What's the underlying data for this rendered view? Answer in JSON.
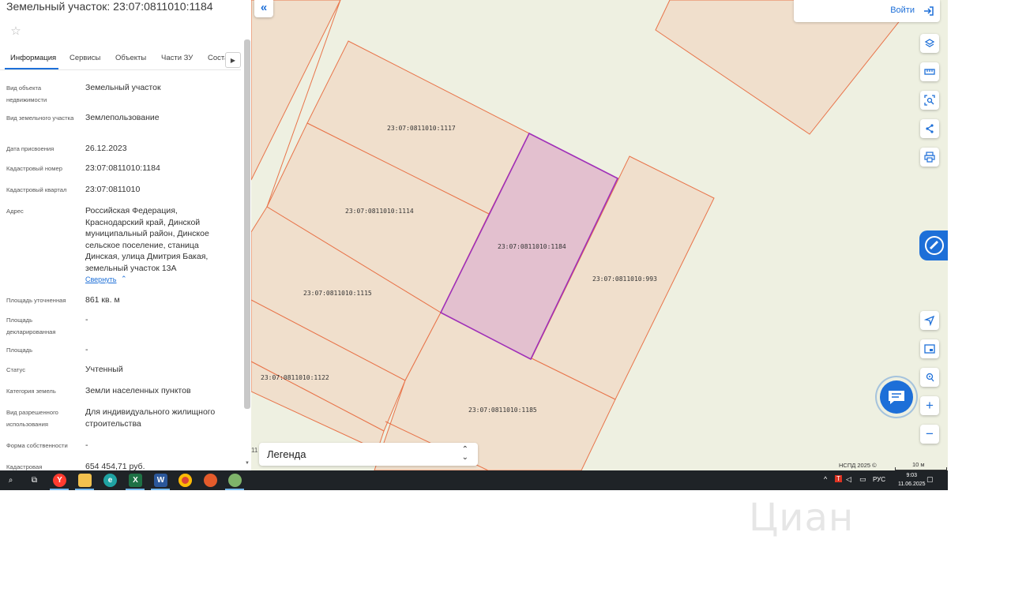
{
  "panel": {
    "title": "Земельный участок: 23:07:0811010:1184",
    "tabs": [
      "Информация",
      "Сервисы",
      "Объекты",
      "Части ЗУ",
      "Соста"
    ],
    "rows": [
      {
        "label": "Вид объекта недвижимости",
        "value": "Земельный участок"
      },
      {
        "label": "Вид земельного участка",
        "value": "Землепользование"
      },
      {
        "label": "Дата присвоения",
        "value": "26.12.2023"
      },
      {
        "label": "Кадастровый номер",
        "value": "23:07:0811010:1184"
      },
      {
        "label": "Кадастровый квартал",
        "value": "23:07:0811010"
      },
      {
        "label": "Адрес",
        "value": "Российская Федерация, Краснодарский край, Динской муниципальный район, Динское сельское поселение, станица Динская, улица Дмитрия Бакая, земельный участок 13А"
      },
      {
        "label": "Площадь уточненная",
        "value": "861 кв. м"
      },
      {
        "label": "Площадь декларированная",
        "value": "-"
      },
      {
        "label": "Площадь",
        "value": "-"
      },
      {
        "label": "Статус",
        "value": "Учтенный"
      },
      {
        "label": "Категория земель",
        "value": "Земли населенных пунктов"
      },
      {
        "label": "Вид разрешенного использования",
        "value": "Для индивидуального жилищного строительства"
      },
      {
        "label": "Форма собственности",
        "value": "-"
      },
      {
        "label": "Кадастровая",
        "value": "654 454,71 руб."
      }
    ],
    "collapse_link": "Свернуть"
  },
  "map": {
    "login_label": "Войти",
    "legend_label": "Легенда",
    "edge_number": "11",
    "attribution": "НСПД 2025 ©",
    "scale_label": "10 м",
    "zoom_in": "+",
    "zoom_out": "−",
    "plots": [
      {
        "id": "23:07:0811010:1117"
      },
      {
        "id": "23:07:0811010:1114"
      },
      {
        "id": "23:07:0811010:1184",
        "selected": true
      },
      {
        "id": "23:07:0811010:1115"
      },
      {
        "id": "23:07:0811010:993"
      },
      {
        "id": "23:07:0811010:1122"
      },
      {
        "id": "23:07:0811010:1185"
      }
    ],
    "colors": {
      "plot_fill": "#f0dfcc",
      "plot_stroke": "#e8744a",
      "selected_fill": "#e3c0cf",
      "selected_stroke": "#a030b8",
      "background": "#eef0e1",
      "accent": "#1d6fd8"
    }
  },
  "taskbar": {
    "apps": [
      "search-icon",
      "task-view-icon",
      "yandex-browser-icon",
      "file-explorer-icon",
      "edge-icon",
      "excel-icon",
      "word-icon",
      "chrome-icon",
      "app-icon",
      "other-app-icon"
    ],
    "lang": "РУС",
    "time": "9:03",
    "date": "11.06.2025"
  },
  "watermark": "Циан"
}
